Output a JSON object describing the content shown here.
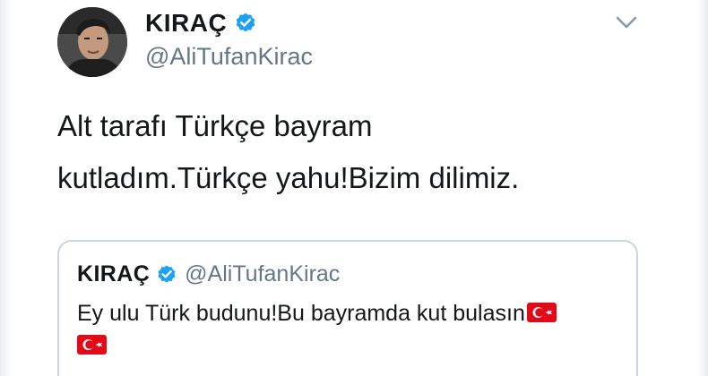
{
  "tweet": {
    "author": {
      "display_name": "KIRAÇ",
      "handle": "@AliTufanKirac",
      "verified": true,
      "avatar_icon": "profile-photo"
    },
    "menu_icon": "chevron-down-icon",
    "text_lines": [
      "Alt tarafı Türkçe bayram",
      "kutladım.Türkçe yahu!Bizim dilimiz."
    ],
    "quoted_tweet": {
      "display_name": "KIRAÇ",
      "handle": "@AliTufanKirac",
      "verified": true,
      "text": "Ey ulu Türk budunu!Bu bayramda kut bulasın",
      "emoji": [
        "turkey-flag",
        "turkey-flag"
      ]
    }
  },
  "colors": {
    "text_primary": "#14171a",
    "text_secondary": "#657786",
    "verified_blue": "#1da1f2",
    "card_border": "#ccd6dd",
    "flag_red": "#e30a17"
  }
}
